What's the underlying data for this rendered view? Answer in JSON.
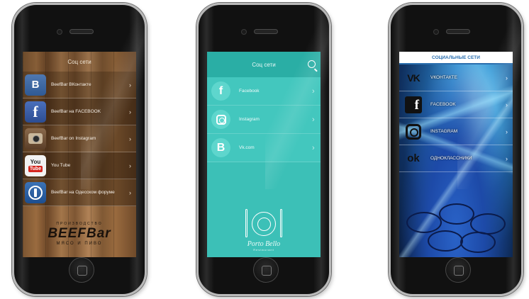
{
  "phones": [
    {
      "header": "Соц сети",
      "items": [
        {
          "icon": "vk-icon",
          "glyph": "B",
          "label": "BeefBar ВКонтакте"
        },
        {
          "icon": "facebook-icon",
          "glyph": "f",
          "label": "BeefBar на FACEBOOK"
        },
        {
          "icon": "instagram-icon",
          "glyph": "",
          "label": "BeefBar on Instagram"
        },
        {
          "icon": "youtube-icon",
          "glyph": "You",
          "glyph2": "Tube",
          "label": "You Tube"
        },
        {
          "icon": "odessa-forum-icon",
          "glyph": "",
          "label": "BeefBar на Одесском форуме"
        }
      ],
      "chevron": "›",
      "logo": {
        "top": "ПРОИЗВОДСТВО",
        "main": "BEEFBar",
        "bottom": "МЯСО И ПИВО"
      }
    },
    {
      "header": "Соц сети",
      "items": [
        {
          "icon": "facebook-icon",
          "glyph": "f",
          "label": "Facebook"
        },
        {
          "icon": "instagram-icon",
          "glyph": "",
          "label": "Instagram"
        },
        {
          "icon": "vk-icon",
          "glyph": "B",
          "label": "Vk.com"
        }
      ],
      "chevron": "›",
      "logo": {
        "name": "Porto Bello",
        "sub": "Restaurant"
      }
    },
    {
      "header": "СОЦИАЛЬНЫЕ СЕТИ",
      "items": [
        {
          "icon": "vk-icon",
          "glyph": "VK",
          "label": "VКОНТАКТЕ"
        },
        {
          "icon": "facebook-icon",
          "glyph": "f",
          "label": "FACEBOOK"
        },
        {
          "icon": "instagram-icon",
          "glyph": "",
          "label": "INSTAGRAM"
        },
        {
          "icon": "odnoklassniki-icon",
          "glyph": "ok",
          "label": "ОДНОКЛАССНИКИ"
        }
      ],
      "chevron": "›"
    }
  ]
}
